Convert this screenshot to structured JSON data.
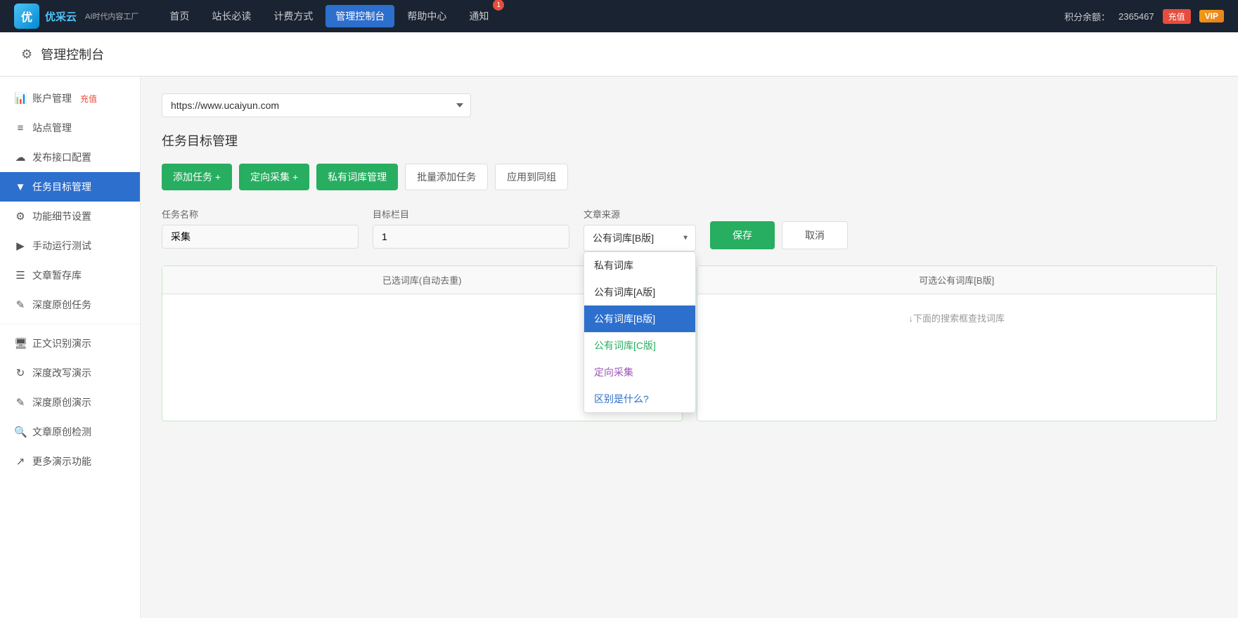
{
  "topNav": {
    "logo": {
      "icon": "优",
      "name": "优采云",
      "subtitle": "AI时代内容工厂"
    },
    "navItems": [
      {
        "id": "home",
        "label": "首页"
      },
      {
        "id": "must-read",
        "label": "站长必读"
      },
      {
        "id": "pricing",
        "label": "计费方式"
      },
      {
        "id": "control",
        "label": "管理控制台",
        "active": true
      },
      {
        "id": "help",
        "label": "帮助中心"
      },
      {
        "id": "notify",
        "label": "通知",
        "badge": "1"
      }
    ],
    "pointsLabel": "积分余额：",
    "pointsValue": "2365467",
    "rechargeLabel": "充值",
    "vipLabel": "VIP"
  },
  "pageHeader": {
    "icon": "⚙",
    "title": "管理控制台"
  },
  "sidebar": {
    "items": [
      {
        "id": "account",
        "icon": "📊",
        "label": "账户管理",
        "recharge": "充值"
      },
      {
        "id": "site",
        "icon": "≡",
        "label": "站点管理"
      },
      {
        "id": "publish",
        "icon": "☁",
        "label": "发布接口配置"
      },
      {
        "id": "task",
        "icon": "▼",
        "label": "任务目标管理",
        "active": true
      },
      {
        "id": "settings",
        "icon": "⚙",
        "label": "功能细节设置"
      },
      {
        "id": "manual",
        "icon": "▶",
        "label": "手动运行测试"
      },
      {
        "id": "drafts",
        "icon": "☰",
        "label": "文章暂存库"
      },
      {
        "id": "original",
        "icon": "✎",
        "label": "深度原创任务"
      },
      {
        "divider": true
      },
      {
        "id": "ocr",
        "icon": "🖥",
        "label": "正文识别演示"
      },
      {
        "id": "rewrite",
        "icon": "↻",
        "label": "深度改写演示"
      },
      {
        "id": "original-demo",
        "icon": "✎",
        "label": "深度原创演示"
      },
      {
        "id": "check",
        "icon": "🔍",
        "label": "文章原创检测"
      },
      {
        "id": "more",
        "icon": "↗",
        "label": "更多演示功能"
      }
    ]
  },
  "main": {
    "siteSelectValue": "https://www.ucaiyun.com",
    "siteSelectOptions": [
      {
        "value": "https://www.ucaiyun.com",
        "label": "https://www.ucaiyun.com"
      }
    ],
    "sectionTitle": "任务目标管理",
    "actionButtons": [
      {
        "id": "add-task",
        "label": "添加任务 +",
        "style": "green"
      },
      {
        "id": "directed-collect",
        "label": "定向采集 +",
        "style": "green"
      },
      {
        "id": "private-lib",
        "label": "私有词库管理",
        "style": "green"
      },
      {
        "id": "batch-add",
        "label": "批量添加任务",
        "style": "outline"
      },
      {
        "id": "apply-group",
        "label": "应用到同组",
        "style": "outline"
      }
    ],
    "form": {
      "taskNameLabel": "任务名称",
      "taskNameValue": "采集",
      "targetColLabel": "目标栏目",
      "targetColValue": "1",
      "sourceLabel": "文章来源",
      "sourceValue": "公有词库[B版]",
      "saveLabel": "保存",
      "cancelLabel": "取消"
    },
    "sourceDropdown": {
      "visible": true,
      "options": [
        {
          "id": "private-lib",
          "label": "私有词库",
          "style": "normal"
        },
        {
          "id": "public-a",
          "label": "公有词库[A版]",
          "style": "normal"
        },
        {
          "id": "public-b",
          "label": "公有词库[B版]",
          "style": "selected"
        },
        {
          "id": "public-c",
          "label": "公有词库[C版]",
          "style": "green"
        },
        {
          "id": "directed",
          "label": "定向采集",
          "style": "purple"
        },
        {
          "id": "diff",
          "label": "区别是什么?",
          "style": "blue-link"
        }
      ]
    },
    "leftPanel": {
      "header": "已选词库(自动去重)"
    },
    "rightPanel": {
      "header": "可选公有词库[B版]",
      "hint": "↓下面的搜索框查找词库"
    }
  }
}
